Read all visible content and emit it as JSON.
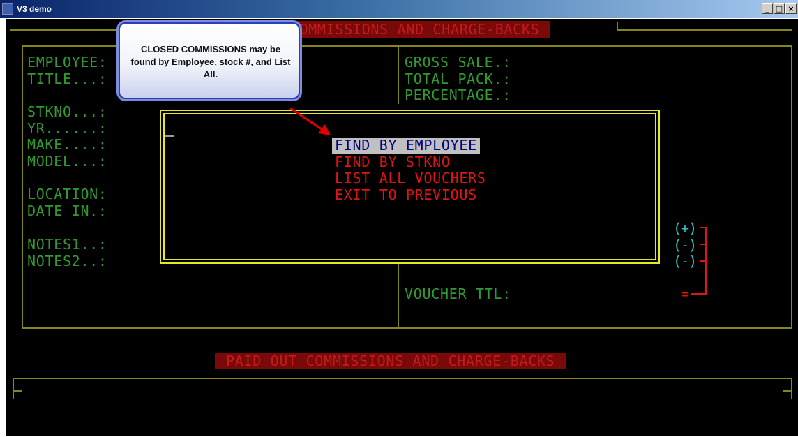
{
  "window": {
    "title": "V3 demo",
    "controls": [
      "_",
      "□",
      "×"
    ]
  },
  "screen": {
    "header_top": "PAID COMMISSIONS AND CHARGE-BACKS",
    "header_bottom": "PAID OUT COMMISSIONS AND CHARGE-BACKS",
    "left_fields": {
      "employee": "EMPLOYEE:",
      "title": "TITLE...:",
      "stkno": "STKNO...:",
      "yr": "YR......:",
      "make": "MAKE....:",
      "model": "MODEL...:",
      "location": "LOCATION:",
      "date_in": "DATE IN.:",
      "notes1": "NOTES1..:",
      "notes2": "NOTES2..:"
    },
    "right_fields": {
      "gross_sale": "GROSS SALE.:",
      "total_pack": "TOTAL PACK.:",
      "percentage": "PERCENTAGE.:",
      "voucher_ttl": "VOUCHER TTL:"
    },
    "menu": [
      {
        "label": "FIND BY EMPLOYEE",
        "selected": true
      },
      {
        "label": "FIND BY STKNO",
        "selected": false
      },
      {
        "label": "LIST ALL VOUCHERS",
        "selected": false
      },
      {
        "label": "EXIT TO PREVIOUS",
        "selected": false
      }
    ],
    "sign_markers": [
      "(+)",
      "(-)",
      "(-)"
    ],
    "equals_marker": "="
  },
  "callout": {
    "text": "CLOSED COMMISSIONS may be found by Employee, stock #, and List All."
  },
  "colors": {
    "label_green": "#2f9a2f",
    "menu_red": "#e01212",
    "highlight_bg": "#c0c0c0",
    "highlight_fg": "#000080",
    "frame_olive": "#85851e",
    "frame_yellow": "#e8e825",
    "header_bg": "#7a0a0a",
    "marker_cyan": "#2fc5c5"
  }
}
